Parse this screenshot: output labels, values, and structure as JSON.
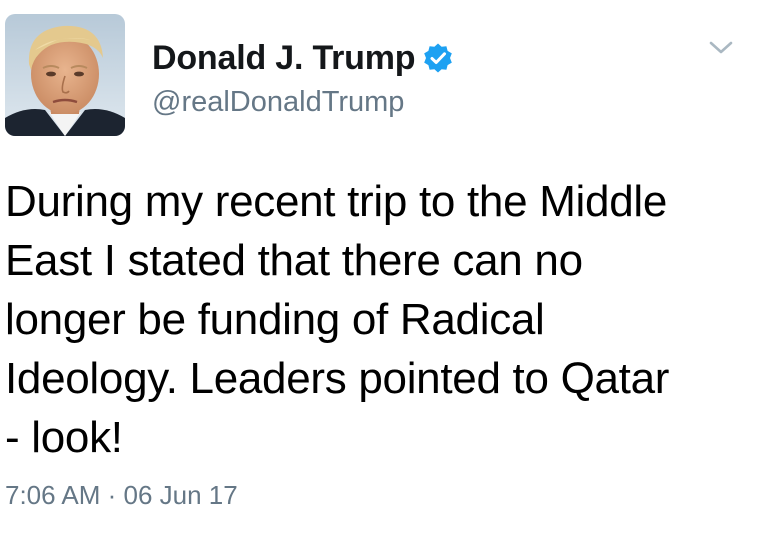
{
  "tweet": {
    "author": {
      "display_name": "Donald J. Trump",
      "handle": "@realDonaldTrump",
      "verified": true,
      "verified_icon": "verified-badge-icon",
      "avatar": "profile-photo"
    },
    "menu_icon": "chevron-down-icon",
    "text": "During my recent trip to the Middle\nEast I stated that there can no\nlonger be funding of Radical\nIdeology. Leaders pointed to Qatar\n- look!",
    "timestamp": "7:06 AM · 06 Jun 17"
  },
  "colors": {
    "accent": "#1da1f2",
    "secondary_text": "#657786",
    "primary_text": "#14171a"
  }
}
